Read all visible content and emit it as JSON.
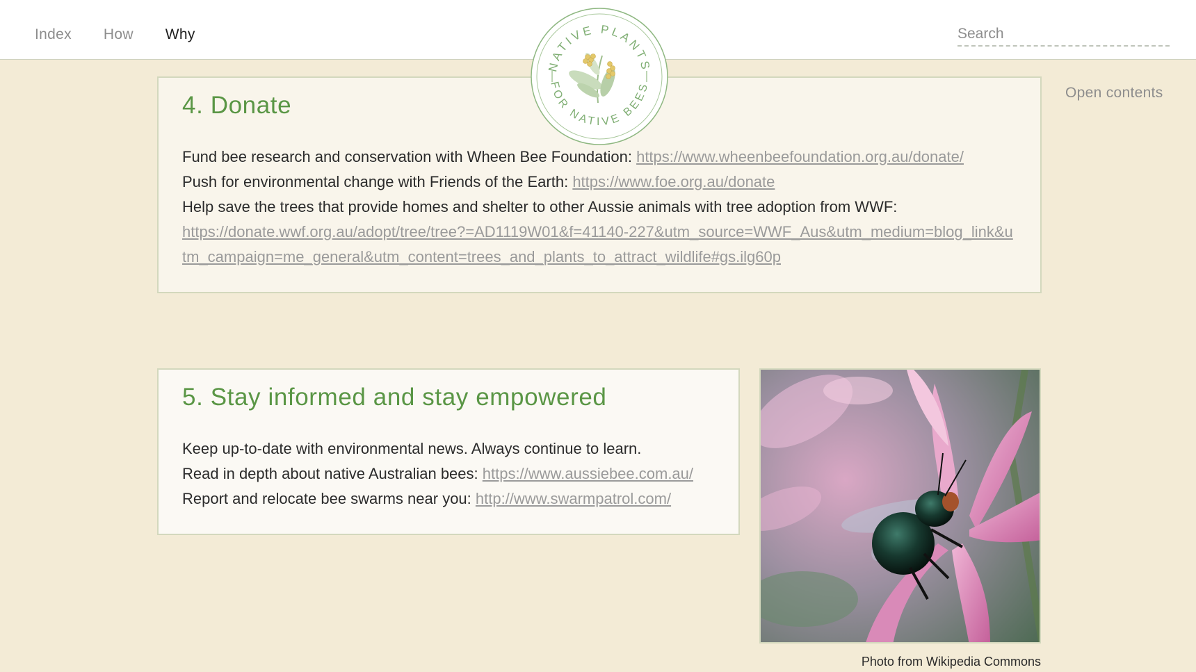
{
  "nav": {
    "items": [
      {
        "label": "Index",
        "active": false
      },
      {
        "label": "How",
        "active": false
      },
      {
        "label": "Why",
        "active": true
      }
    ]
  },
  "search": {
    "placeholder": "Search"
  },
  "logo": {
    "top_text": "NATIVE PLANTS",
    "bottom_text": "FOR NATIVE BEES"
  },
  "open_contents": "Open contents",
  "donate": {
    "title": "4. Donate",
    "line1_text": "Fund bee research and conservation with Wheen Bee Foundation: ",
    "line1_link": "https://www.wheenbeefoundation.org.au/donate/",
    "line2_text": "Push for environmental change with Friends of the Earth: ",
    "line2_link": "https://www.foe.org.au/donate",
    "line3_text": "Help save the trees that provide homes and shelter to other Aussie animals with tree adoption from WWF:",
    "line3_link": "https://donate.wwf.org.au/adopt/tree/tree?=AD1119W01&f=41140-227&utm_source=WWF_Aus&utm_medium=blog_link&utm_campaign=me_general&utm_content=trees_and_plants_to_attract_wildlife#gs.ilg60p"
  },
  "stay": {
    "title": "5. Stay informed and stay empowered",
    "line1_text": "Keep up-to-date with environmental news. Always continue to learn.",
    "line2_text": "Read in depth about native Australian bees: ",
    "line2_link": "https://www.aussiebee.com.au/",
    "line3_text": "Report and relocate bee swarms near you: ",
    "line3_link": "http://www.swarmpatrol.com/"
  },
  "photo": {
    "caption": "Photo from Wikipedia Commons"
  },
  "colors": {
    "background": "#f3ebd6",
    "heading_green": "#5a9645",
    "link_grey": "#9a9a9a",
    "card_border": "#d3d8bd"
  }
}
